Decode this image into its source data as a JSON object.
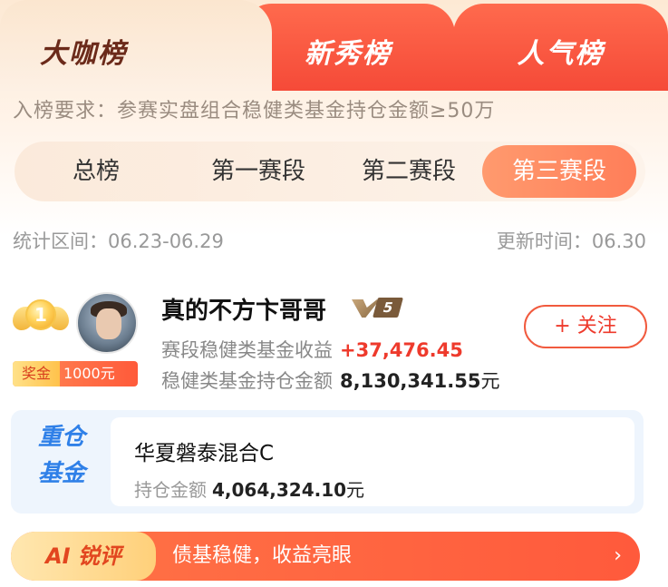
{
  "tabs": [
    {
      "label": "大咖榜",
      "active": true
    },
    {
      "label": "新秀榜",
      "active": false
    },
    {
      "label": "人气榜",
      "active": false
    }
  ],
  "requirement": "入榜要求：参赛实盘组合稳健类基金持仓金额≥50万",
  "segments": [
    {
      "label": "总榜",
      "active": false
    },
    {
      "label": "第一赛段",
      "active": false
    },
    {
      "label": "第二赛段",
      "active": false
    },
    {
      "label": "第三赛段",
      "active": true
    }
  ],
  "stats": {
    "period": "统计区间：06.23-06.29",
    "updated": "更新时间：06.30"
  },
  "entry": {
    "rank": "1",
    "award_tag": "奖金",
    "award_amount": "1000元",
    "username": "真的不方卞哥哥",
    "level": "5",
    "return_label": "赛段稳健类基金收益",
    "return_value": "+37,476.45",
    "holding_label": "稳健类基金持仓金额",
    "holding_value": "8,130,341.55",
    "holding_unit": "元",
    "follow_label": "+ 关注"
  },
  "fund": {
    "tag_line1": "重仓",
    "tag_line2": "基金",
    "name": "华夏磐泰混合C",
    "holding_label": "持仓金额",
    "holding_value": "4,064,324.10",
    "holding_unit": "元"
  },
  "ai": {
    "tag": "AI 锐评",
    "text": "债基稳健，收益亮眼",
    "arrow": "›"
  },
  "colors": {
    "accent": "#f54a38",
    "gain": "#ee3a2c",
    "fund_blue": "#2f80e8"
  }
}
